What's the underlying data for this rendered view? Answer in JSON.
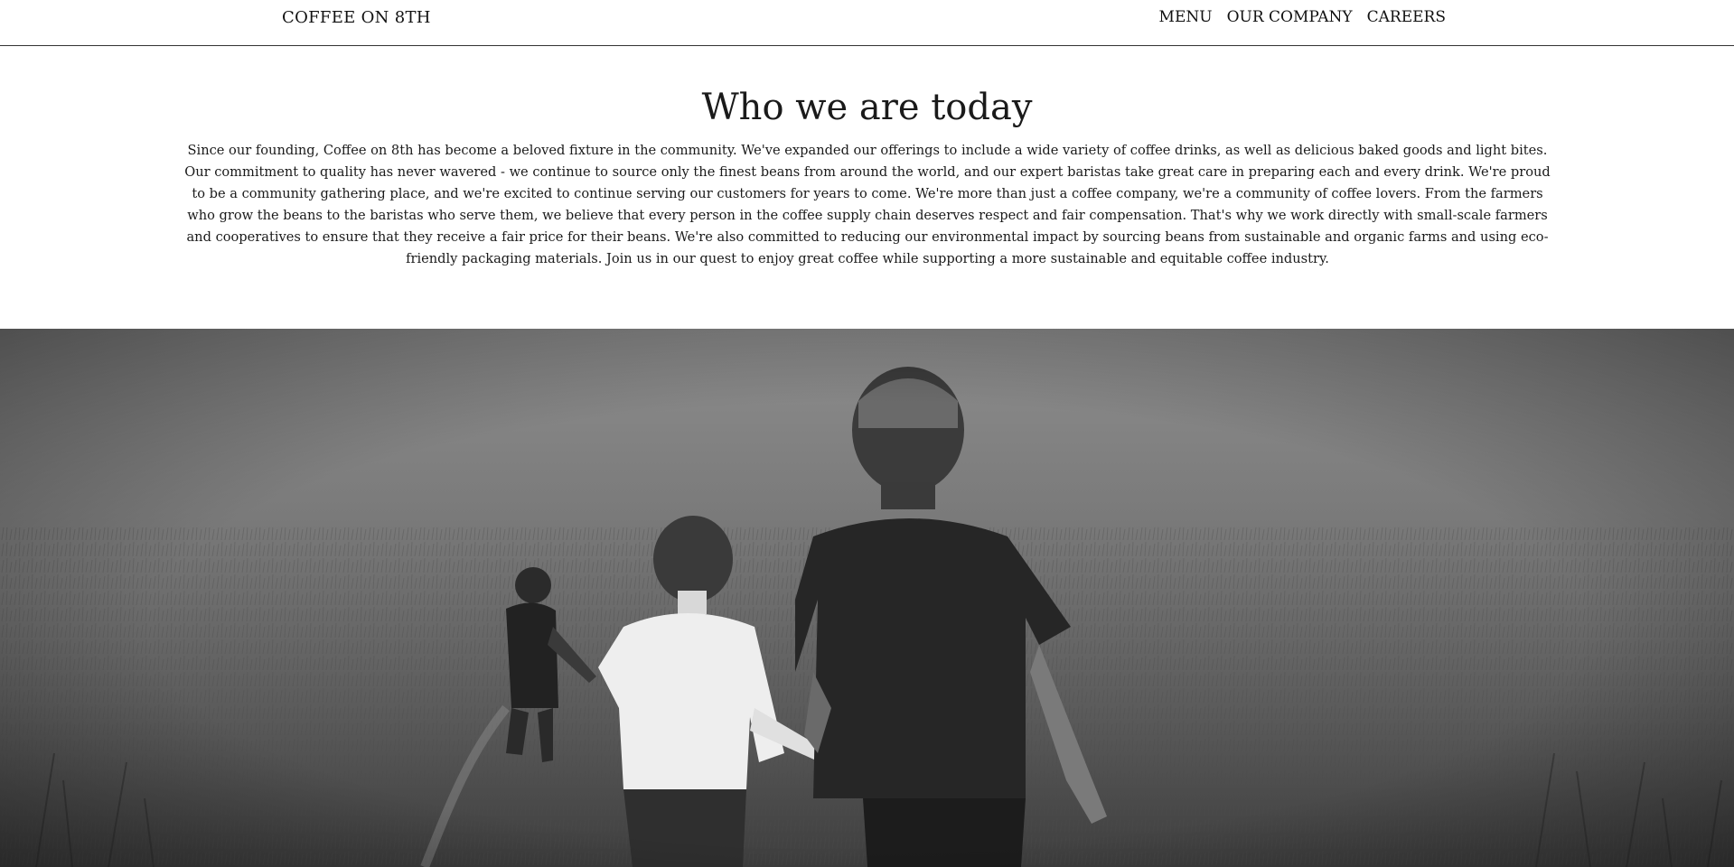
{
  "header": {
    "brand": "COFFEE ON 8TH",
    "nav": [
      "MENU",
      "OUR COMPANY",
      "CAREERS"
    ]
  },
  "about": {
    "title": "Who we are today",
    "body": "Since our founding, Coffee on 8th has become a beloved fixture in the community. We've expanded our offerings to include a wide variety of coffee drinks, as well as delicious baked goods and light bites. Our commitment to quality has never wavered - we continue to source only the finest beans from around the world, and our expert baristas take great care in preparing each and every drink. We're proud to be a community gathering place, and we're excited to continue serving our customers for years to come. We're more than just a coffee company, we're a community of coffee lovers. From the farmers who grow the beans to the baristas who serve them, we believe that every person in the coffee supply chain deserves respect and fair compensation. That's why we work directly with small-scale farmers and cooperatives to ensure that they receive a fair price for their beans. We're also committed to reducing our environmental impact by sourcing beans from sustainable and organic farms and using eco-friendly packaging materials. Join us in our quest to enjoy great coffee while supporting a more sustainable and equitable coffee industry."
  },
  "hero": {
    "image_subject": "three children running through a grassy field, black and white"
  }
}
